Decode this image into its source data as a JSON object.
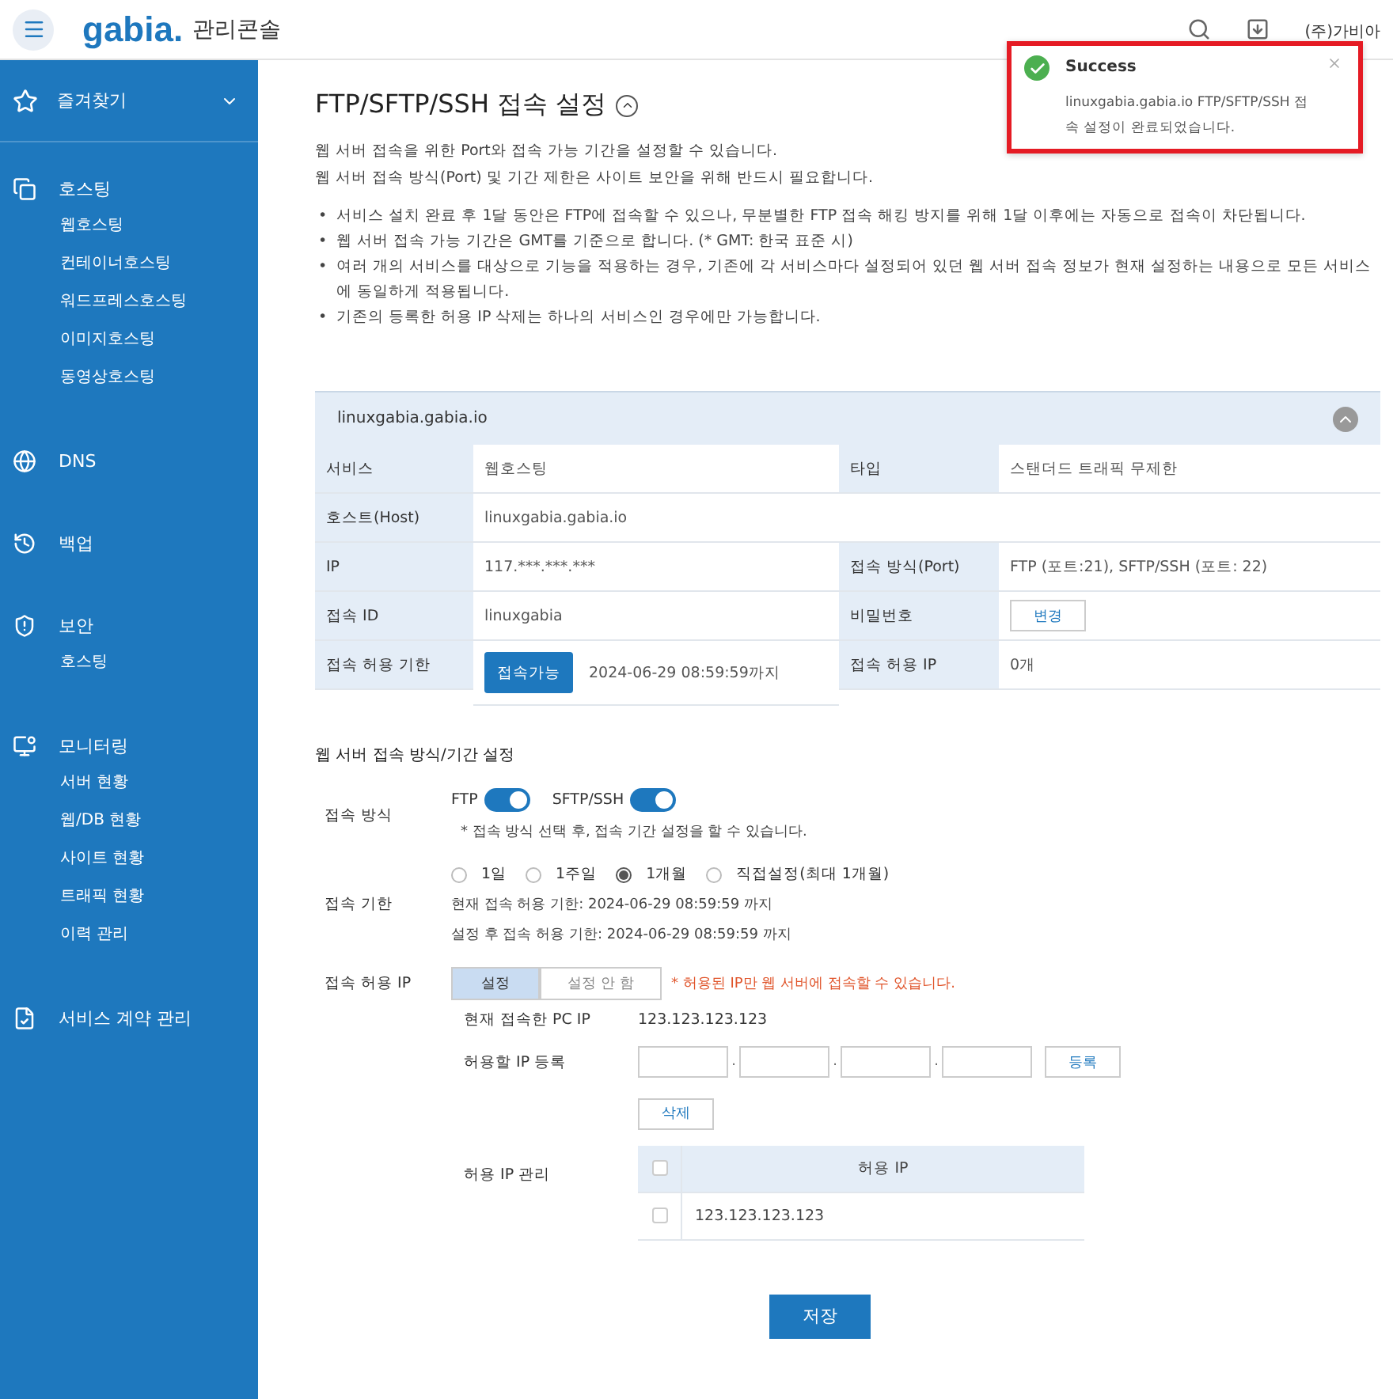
{
  "header": {
    "logo": "gabia.",
    "app_name": "관리콘솔",
    "user": "(주)가비아"
  },
  "sidebar": {
    "favorites": {
      "label": "즐겨찾기",
      "expanded": false
    },
    "groups": [
      {
        "label": "호스팅",
        "children": [
          {
            "label": "웹호스팅"
          },
          {
            "label": "컨테이너호스팅"
          },
          {
            "label": "워드프레스호스팅"
          },
          {
            "label": "이미지호스팅"
          },
          {
            "label": "동영상호스팅"
          }
        ]
      },
      {
        "label": "DNS"
      },
      {
        "label": "백업"
      },
      {
        "label": "보안",
        "children": [
          {
            "label": "호스팅"
          }
        ]
      },
      {
        "label": "모니터링",
        "children": [
          {
            "label": "서버 현황"
          },
          {
            "label": "웹/DB 현황"
          },
          {
            "label": "사이트 현황"
          },
          {
            "label": "트래픽 현황"
          },
          {
            "label": "이력 관리"
          }
        ]
      },
      {
        "label": "서비스 계약 관리"
      }
    ]
  },
  "page": {
    "title": "FTP/SFTP/SSH 접속 설정",
    "intro": [
      "웹 서버 접속을 위한 Port와 접속 가능 기간을 설정할 수 있습니다.",
      "웹 서버 접속 방식(Port) 및 기간 제한은 사이트 보안을 위해 반드시 필요합니다."
    ],
    "bullet_marker": "•",
    "bullets": [
      "서비스 설치 완료 후 1달 동안은 FTP에 접속할 수 있으나, 무분별한 FTP 접속 해킹 방지를 위해 1달 이후에는 자동으로 접속이 차단됩니다.",
      "웹 서버 접속 가능 기간은 GMT를 기준으로 합니다. (* GMT: 한국 표준 시)",
      "여러 개의 서비스를 대상으로 기능을 적용하는 경우, 기존에 각 서비스마다 설정되어 있던 웹 서버 접속 정보가 현재 설정하는 내용으로 모든 서비스에 동일하게 적용됩니다.",
      "기존의 등록한 허용 IP 삭제는 하나의 서비스인 경우에만 가능합니다."
    ]
  },
  "info": {
    "title": "linuxgabia.gabia.io",
    "expanded": true,
    "rows": [
      {
        "cells": [
          {
            "kind": "head",
            "text": "서비스"
          },
          {
            "kind": "text",
            "text": "웹호스팅"
          },
          {
            "kind": "head",
            "text": "타입"
          },
          {
            "kind": "text",
            "text": "스탠더드 트래픽 무제한"
          }
        ]
      },
      {
        "cells": [
          {
            "kind": "head",
            "text": "호스트(Host)"
          },
          {
            "kind": "wide",
            "text": "linuxgabia.gabia.io"
          }
        ]
      },
      {
        "cells": [
          {
            "kind": "head",
            "text": "IP"
          },
          {
            "kind": "text",
            "text": "117.***.***.***"
          },
          {
            "kind": "head",
            "text": "접속 방식(Port)"
          },
          {
            "kind": "text",
            "text": "FTP (포트:21), SFTP/SSH (포트: 22)"
          }
        ]
      },
      {
        "cells": [
          {
            "kind": "head",
            "text": "접속 ID"
          },
          {
            "kind": "text",
            "text": "linuxgabia"
          },
          {
            "kind": "head",
            "text": "비밀번호"
          },
          {
            "kind": "button",
            "text": "변경"
          }
        ]
      },
      {
        "cells": [
          {
            "kind": "head",
            "text": "접속 허용 기한"
          },
          {
            "kind": "status",
            "button": "접속가능",
            "text": "2024-06-29 08:59:59까지"
          },
          {
            "kind": "head",
            "text": "접속 허용 IP"
          },
          {
            "kind": "text",
            "text": "0개"
          }
        ]
      }
    ]
  },
  "settings": {
    "title": "웹 서버 접속 방식/기간 설정",
    "method": {
      "label": "접속 방식",
      "toggles": [
        {
          "label": "FTP",
          "on": true
        },
        {
          "label": "SFTP/SSH",
          "on": true
        }
      ],
      "note": "* 접속 방식 선택 후, 접속 기간 설정을 할 수 있습니다."
    },
    "period": {
      "label": "접속 기한",
      "options": [
        {
          "label": "1일",
          "selected": false
        },
        {
          "label": "1주일",
          "selected": false
        },
        {
          "label": "1개월",
          "selected": true
        },
        {
          "label": "직접설정(최대 1개월)",
          "selected": false
        }
      ],
      "current": "현재 접속 허용 기한: 2024-06-29 08:59:59 까지",
      "after": "설정 후 접속 허용 기한: 2024-06-29 08:59:59 까지"
    },
    "allowed_ip": {
      "label": "접속 허용 IP",
      "options": [
        {
          "label": "설정",
          "selected": true
        },
        {
          "label": "설정 안 함",
          "selected": false
        }
      ],
      "warning": "* 허용된 IP만 웹 서버에 접속할 수 있습니다.",
      "current_label": "현재 접속한 PC IP",
      "current_value": "123.123.123.123",
      "register_label": "허용할 IP 등록",
      "separators": [
        ".",
        ".",
        "."
      ],
      "register_button": "등록",
      "delete_button": "삭제",
      "manage_label": "허용 IP 관리",
      "table": {
        "all_checked": false,
        "column": "허용 IP",
        "rows": [
          {
            "ip": "123.123.123.123",
            "checked": false
          }
        ]
      }
    }
  },
  "save_button": "저장",
  "toast": {
    "title": "Success",
    "message": "linuxgabia.gabia.io  FTP/SFTP/SSH 접속 설정이 완료되었습니다."
  }
}
